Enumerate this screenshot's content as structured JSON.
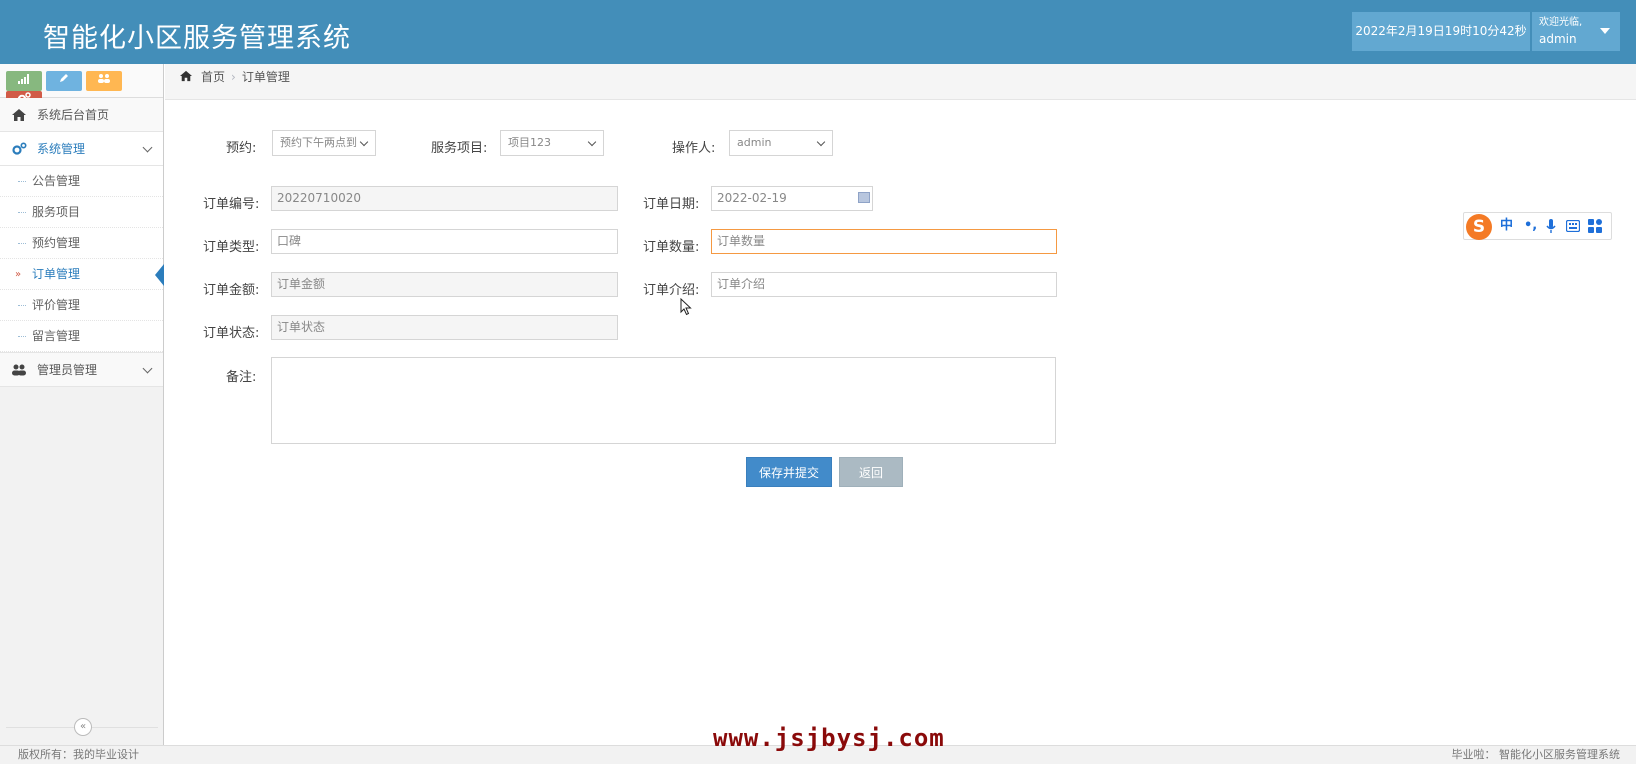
{
  "header": {
    "title": "智能化小区服务管理系统",
    "datetime": "2022年2月19日19时10分42秒",
    "welcome": "欢迎光临,",
    "username": "admin"
  },
  "sidebar": {
    "home": "系统后台首页",
    "system_mgmt": "系统管理",
    "sub_items": [
      "公告管理",
      "服务项目",
      "预约管理",
      "订单管理",
      "评价管理",
      "留言管理"
    ],
    "admin_mgmt": "管理员管理",
    "collapse_symbol": "«"
  },
  "breadcrumb": {
    "home": "首页",
    "current": "订单管理"
  },
  "form": {
    "reservation": {
      "label": "预约:",
      "value": "预约下午两点到"
    },
    "service_item": {
      "label": "服务项目:",
      "value": "项目123"
    },
    "operator": {
      "label": "操作人:",
      "value": "admin"
    },
    "order_no": {
      "label": "订单编号:",
      "value": "20220710020"
    },
    "order_date": {
      "label": "订单日期:",
      "value": "2022-02-19"
    },
    "order_type": {
      "label": "订单类型:",
      "value": "口碑"
    },
    "order_qty": {
      "label": "订单数量:",
      "placeholder": "订单数量"
    },
    "order_amount": {
      "label": "订单金额:",
      "placeholder": "订单金额"
    },
    "order_intro": {
      "label": "订单介绍:",
      "placeholder": "订单介绍"
    },
    "order_status": {
      "label": "订单状态:",
      "placeholder": "订单状态"
    },
    "remark": {
      "label": "备注:"
    },
    "save_button": "保存并提交",
    "back_button": "返回"
  },
  "ime": {
    "logo": "S",
    "mode": "中"
  },
  "footer": {
    "copyright": "版权所有：我的毕业设计",
    "right": "毕业啦：  智能化小区服务管理系统",
    "watermark": "www.jsjbysj.com"
  },
  "colors": {
    "header_bg": "#438eb9",
    "primary_button": "#428bca",
    "back_button": "#abbac3",
    "active_nav": "#2b7dbc",
    "focus_border": "#f59942"
  }
}
